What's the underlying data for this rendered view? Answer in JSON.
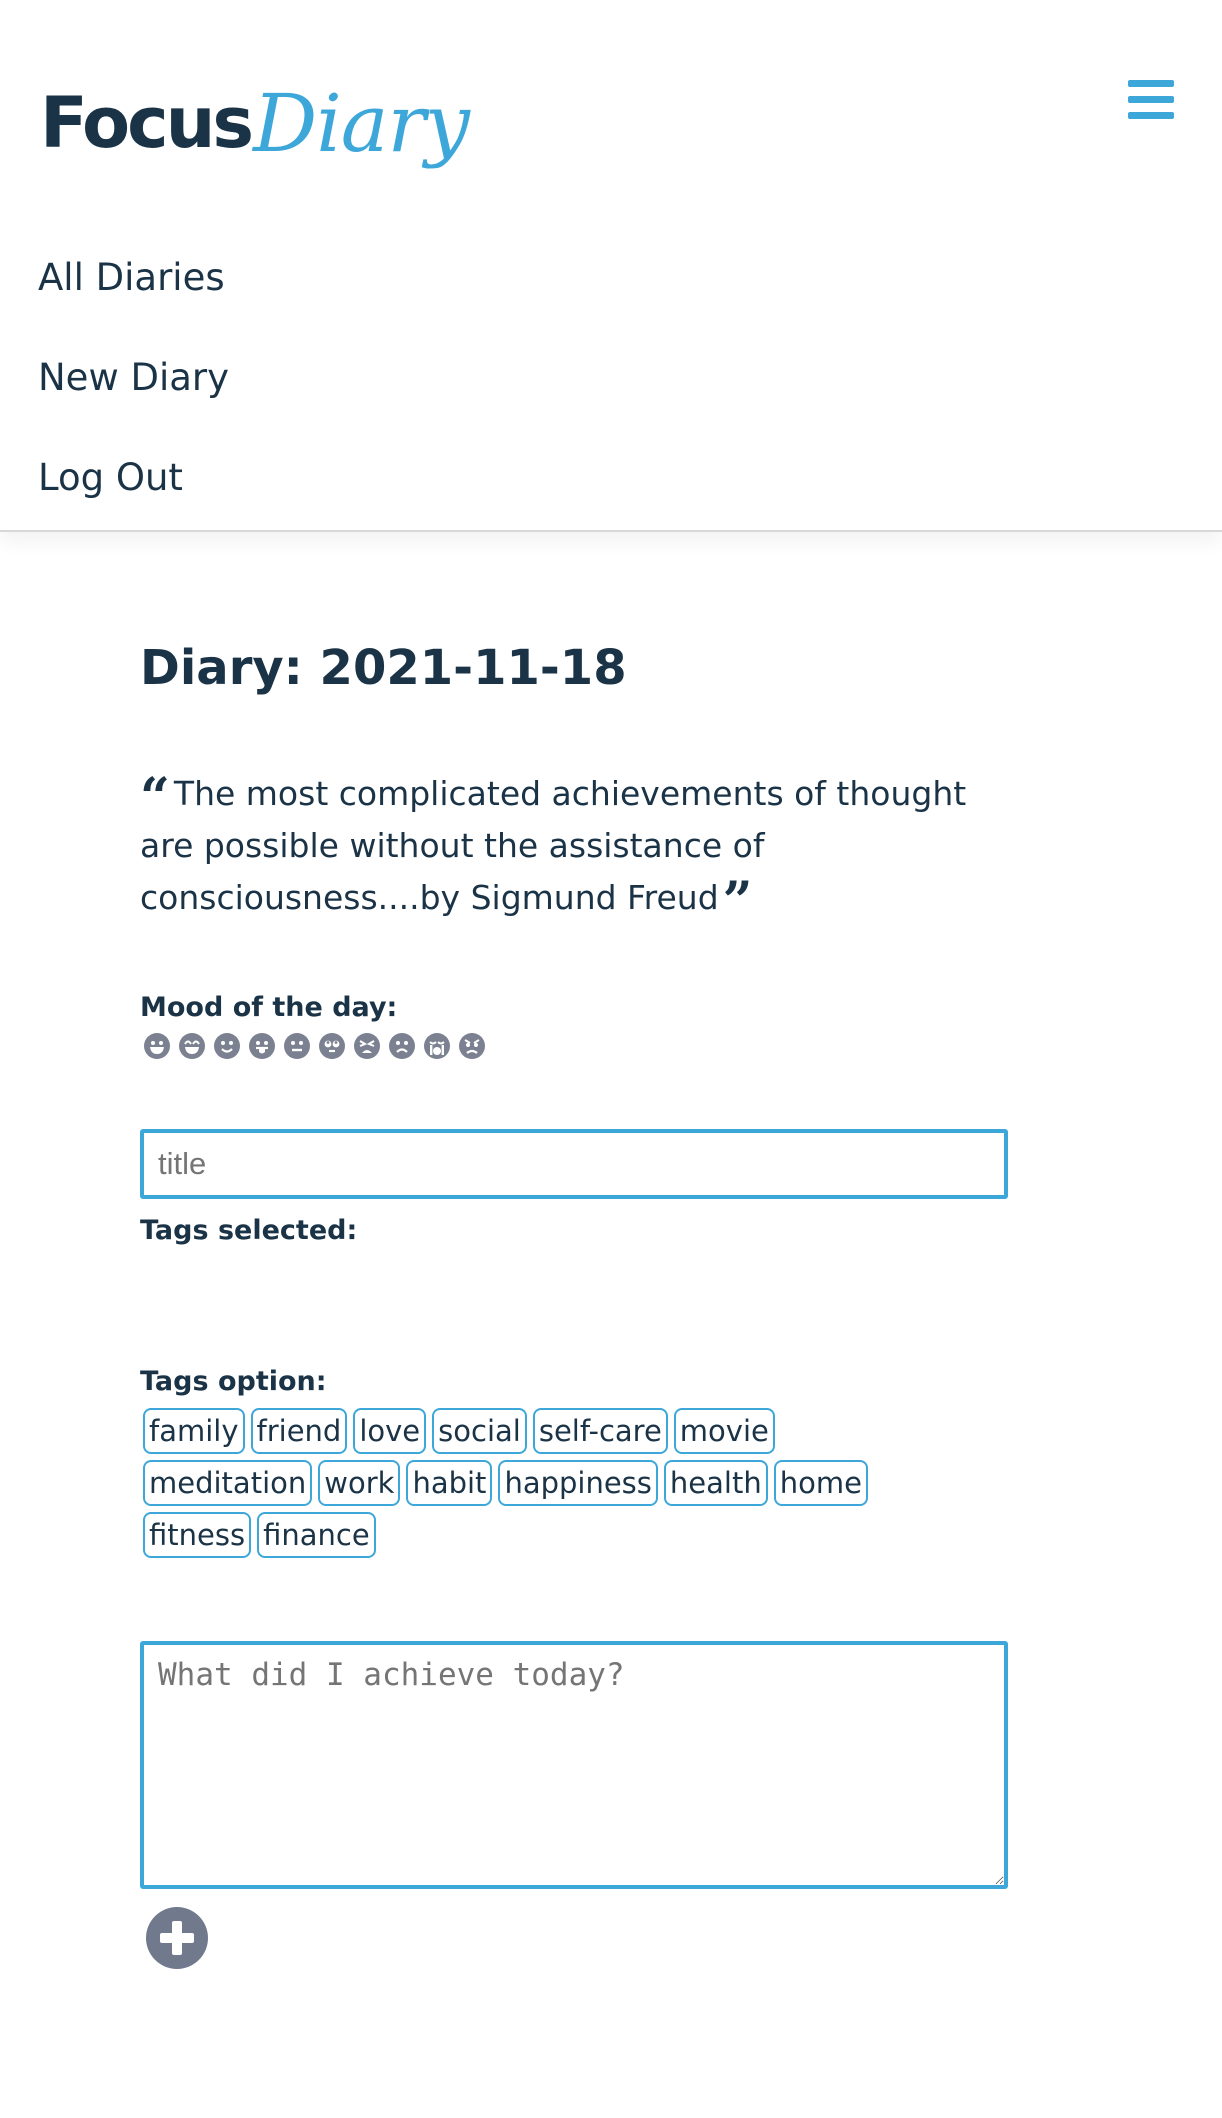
{
  "brand": {
    "focus": "Focus",
    "diary": "Diary",
    "accent_color": "#3ea7d9",
    "text_color": "#1b3346"
  },
  "header": {
    "menu_icon": "hamburger-icon"
  },
  "nav": {
    "items": [
      {
        "label": "All Diaries"
      },
      {
        "label": "New Diary"
      },
      {
        "label": "Log Out"
      }
    ]
  },
  "page": {
    "title": "Diary: 2021-11-18"
  },
  "quote": {
    "text": "The most complicated achievements of thought are possible without the assistance of consciousness....by Sigmund Freud",
    "open_mark": "“",
    "close_mark": "”"
  },
  "mood": {
    "label": "Mood of the day:",
    "icons": [
      "grin-face-icon",
      "beam-face-icon",
      "smile-face-icon",
      "tongue-face-icon",
      "neutral-face-icon",
      "rolling-eyes-face-icon",
      "tired-face-icon",
      "frown-face-icon",
      "cry-face-icon",
      "angry-face-icon"
    ]
  },
  "form": {
    "title_placeholder": "title",
    "title_value": "",
    "tags_selected_label": "Tags selected:",
    "tags_option_label": "Tags option:",
    "tags": [
      "family",
      "friend",
      "love",
      "social",
      "self-care",
      "movie",
      "meditation",
      "work",
      "habit",
      "happiness",
      "health",
      "home",
      "fitness",
      "finance"
    ],
    "content_placeholder": "What did I achieve today?",
    "content_value": "",
    "add_icon": "plus-circle-icon"
  }
}
